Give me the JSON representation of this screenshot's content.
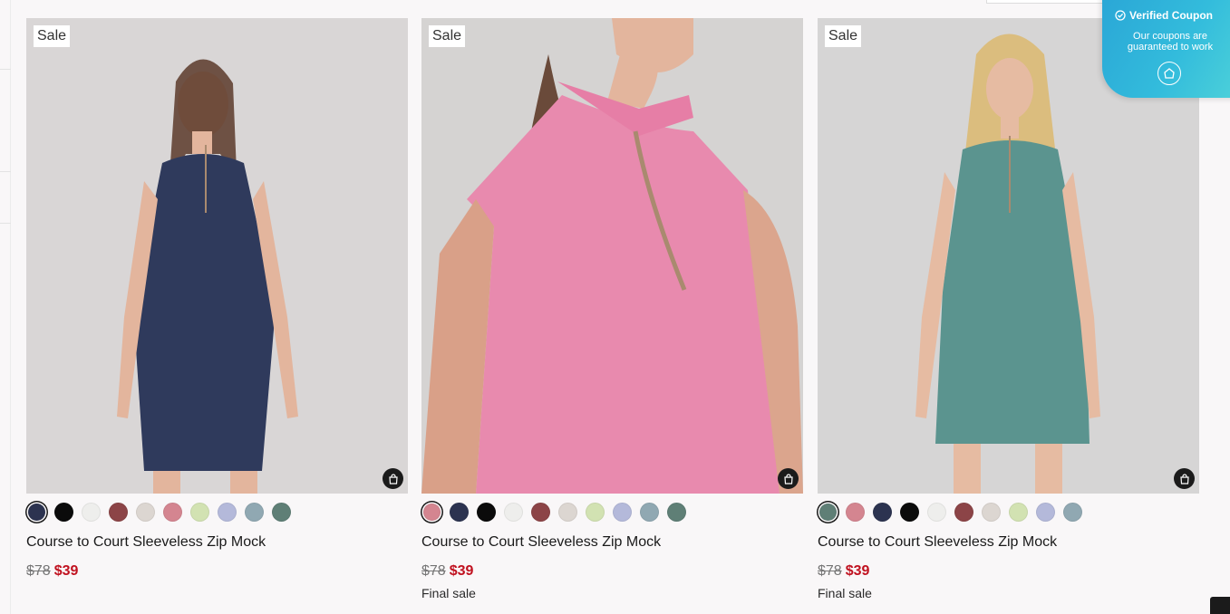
{
  "coupon": {
    "title": "Verified Coupon",
    "subtitle": "Our coupons are guaranteed to work",
    "color": "#33bcdc"
  },
  "products": [
    {
      "badge": "Sale",
      "name": "Course to Court Sleeveless Zip Mock",
      "price_original": "$78",
      "price_sale": "$39",
      "final_sale": "",
      "image_color": "#2f3a5c",
      "swatches": [
        "#2c3350",
        "#0b0b0b",
        "#eeeeec",
        "#8c4447",
        "#dcd6d1",
        "#d48590",
        "#d2e2b2",
        "#b4b9da",
        "#90a8b2",
        "#5f7f76"
      ],
      "selected_swatch": 0
    },
    {
      "badge": "Sale",
      "name": "Course to Court Sleeveless Zip Mock",
      "price_original": "$78",
      "price_sale": "$39",
      "final_sale": "Final sale",
      "image_color": "#e88aae",
      "swatches": [
        "#d48590",
        "#2c3350",
        "#0b0b0b",
        "#eeeeec",
        "#8c4447",
        "#dcd6d1",
        "#d2e2b2",
        "#b4b9da",
        "#90a8b2",
        "#5f7f76"
      ],
      "selected_swatch": 0
    },
    {
      "badge": "Sale",
      "name": "Course to Court Sleeveless Zip Mock",
      "price_original": "$78",
      "price_sale": "$39",
      "final_sale": "Final sale",
      "image_color": "#5b948f",
      "swatches": [
        "#5f7f76",
        "#d48590",
        "#2c3350",
        "#0b0b0b",
        "#eeeeec",
        "#8c4447",
        "#dcd6d1",
        "#d2e2b2",
        "#b4b9da",
        "#90a8b2"
      ],
      "selected_swatch": 0
    }
  ]
}
